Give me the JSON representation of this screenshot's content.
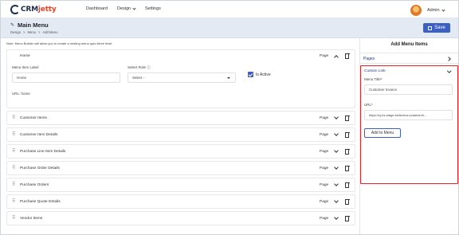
{
  "nav": {
    "logo_crm": "CRM",
    "logo_jetty": "jetty",
    "items": [
      "Dashboard",
      "Design",
      "Settings"
    ],
    "user": "Admin"
  },
  "header": {
    "title": "Main Menu",
    "breadcrumb": [
      "Design",
      ">",
      "Menu",
      ">",
      "Add Menu"
    ],
    "save_label": "Save"
  },
  "note": "Note: Menu Builder will allow you to create a nesting menu upto three level.",
  "expanded_item": {
    "title": "Home",
    "type": "Page",
    "label_field_label": "Menu Item Label",
    "label_value": "Home",
    "role_label": "Select Role",
    "role_value": "Select -",
    "is_active_label": "Is Active",
    "url_text": "URL: home"
  },
  "items": [
    {
      "title": "Customer Items",
      "type": "Page"
    },
    {
      "title": "Customer Item Details",
      "type": "Page"
    },
    {
      "title": "Purchase Line Item Details",
      "type": "Page"
    },
    {
      "title": "Purchase Order Details",
      "type": "Page"
    },
    {
      "title": "Purchase Orders",
      "type": "Page"
    },
    {
      "title": "Purchase Quote Details",
      "type": "Page"
    },
    {
      "title": "Vendor Items",
      "type": "Page"
    }
  ],
  "right": {
    "title": "Add Menu Items",
    "pages_label": "Pages",
    "custom_link": {
      "title": "Custom Link",
      "menu_title_label": "Menu Title*",
      "menu_title_value": "Customer Invoice",
      "url_label": "URL*",
      "url_value": "https://cj-bs-stage.biztechcs.io/admin/h...",
      "button_label": "Add to Menu"
    }
  },
  "colors": {
    "primary": "#3b5fc2",
    "header_bg": "#e4eaf4",
    "highlight": "#e0262d",
    "logo_accent": "#e8442c",
    "logo_dark": "#1c2b4a"
  }
}
